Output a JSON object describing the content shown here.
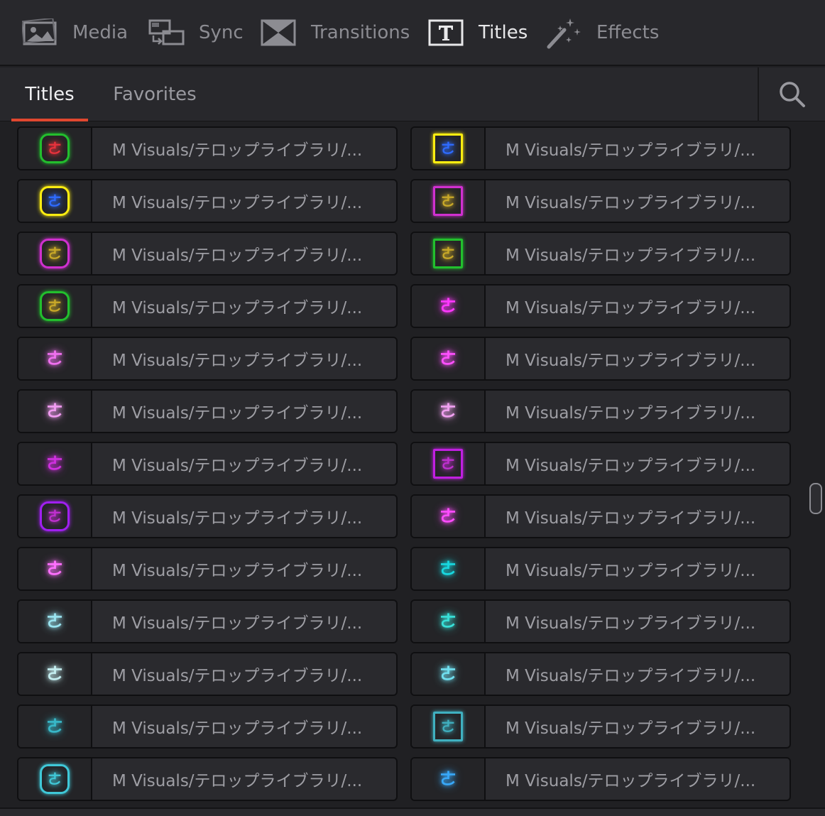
{
  "toolbar": {
    "tools": [
      {
        "label": "Media",
        "icon": "image-icon",
        "active": false
      },
      {
        "label": "Sync",
        "icon": "sync-icon",
        "active": false
      },
      {
        "label": "Transitions",
        "icon": "transition-icon",
        "active": false
      },
      {
        "label": "Titles",
        "icon": "title-t-icon",
        "active": true
      },
      {
        "label": "Effects",
        "icon": "magic-wand-icon",
        "active": false
      }
    ]
  },
  "tabs": {
    "items": [
      {
        "label": "Titles",
        "active": true
      },
      {
        "label": "Favorites",
        "active": false
      }
    ],
    "search_icon": "search-icon"
  },
  "titles": {
    "item_label": "M Visuals/テロップライブラリ/...",
    "glyph": "ㄜ",
    "items": [
      {
        "color": "#e8323c",
        "border": "#22c02e",
        "frame": "rounded"
      },
      {
        "color": "#2e6bff",
        "border": "#ffee10",
        "frame": "square"
      },
      {
        "color": "#2e6bff",
        "border": "#ffee10",
        "frame": "rounded"
      },
      {
        "color": "#c8a828",
        "border": "#d030d0",
        "frame": "square"
      },
      {
        "color": "#c8a828",
        "border": "#d030d0",
        "frame": "rounded"
      },
      {
        "color": "#c8a828",
        "border": "#22c02e",
        "frame": "square"
      },
      {
        "color": "#c8a828",
        "border": "#22c02e",
        "frame": "rounded"
      },
      {
        "color": "#ff38ff",
        "border": "",
        "frame": "none"
      },
      {
        "color": "#f070f0",
        "border": "",
        "frame": "none"
      },
      {
        "color": "#ff50ff",
        "border": "",
        "frame": "none"
      },
      {
        "color": "#f29cf2",
        "border": "",
        "frame": "none"
      },
      {
        "color": "#f0a0f0",
        "border": "",
        "frame": "none"
      },
      {
        "color": "#d030e0",
        "border": "",
        "frame": "none"
      },
      {
        "color": "#c030d0",
        "border": "#c020e0",
        "frame": "square"
      },
      {
        "color": "#c030d0",
        "border": "#a020f0",
        "frame": "rounded"
      },
      {
        "color": "#ff4cff",
        "border": "",
        "frame": "none"
      },
      {
        "color": "#ff70ff",
        "border": "",
        "frame": "none"
      },
      {
        "color": "#18d8e0",
        "border": "",
        "frame": "none"
      },
      {
        "color": "#9ae4f0",
        "border": "",
        "frame": "none"
      },
      {
        "color": "#38e0d8",
        "border": "",
        "frame": "none"
      },
      {
        "color": "#c4eef0",
        "border": "",
        "frame": "none"
      },
      {
        "color": "#70e0f0",
        "border": "",
        "frame": "none"
      },
      {
        "color": "#38b8c8",
        "border": "",
        "frame": "none"
      },
      {
        "color": "#40b0c0",
        "border": "#40b0c0",
        "frame": "square"
      },
      {
        "color": "#40c8d8",
        "border": "#40c8d8",
        "frame": "rounded"
      },
      {
        "color": "#38a8f8",
        "border": "",
        "frame": "none"
      }
    ]
  }
}
